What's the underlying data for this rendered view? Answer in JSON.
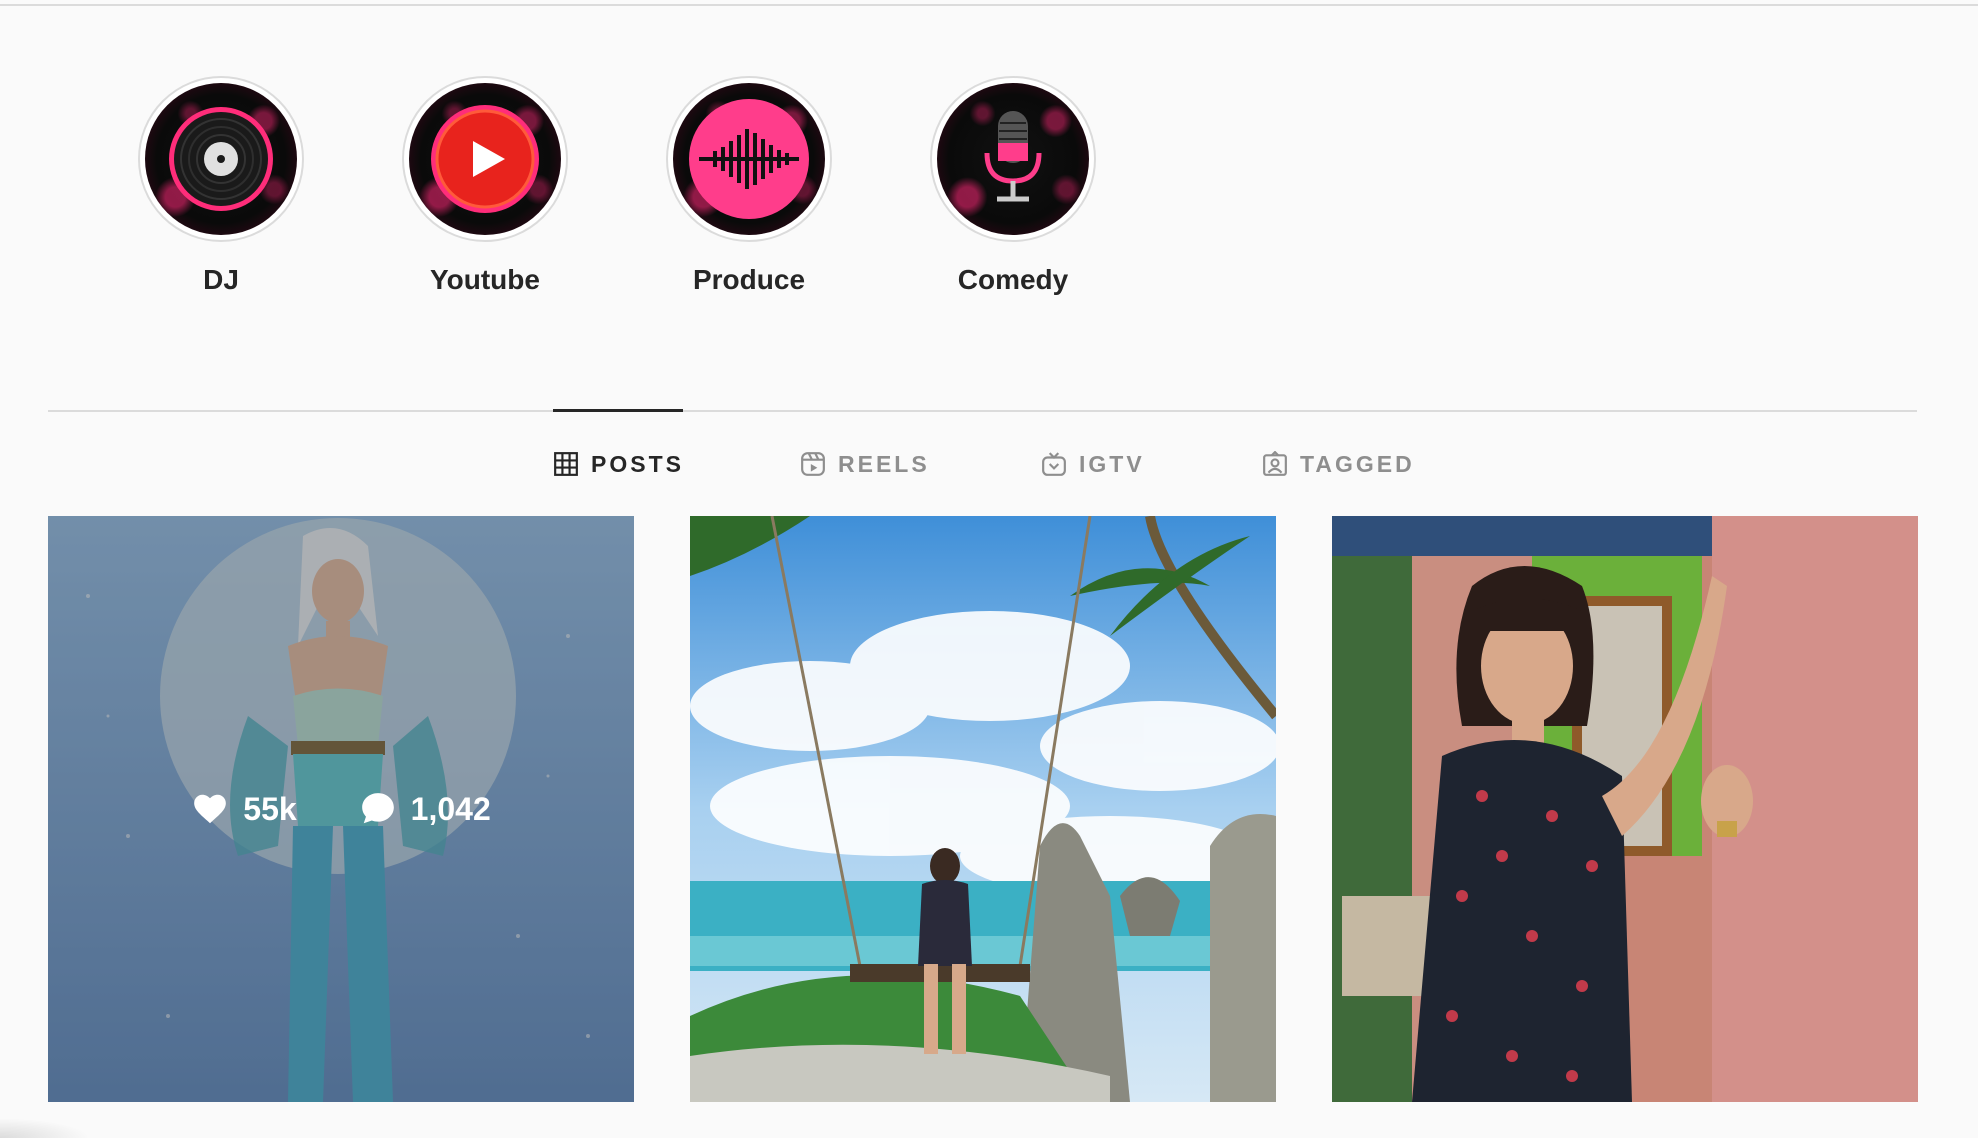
{
  "highlights": [
    {
      "label": "DJ",
      "icon": "vinyl-record-icon"
    },
    {
      "label": "Youtube",
      "icon": "play-button-icon"
    },
    {
      "label": "Produce",
      "icon": "sound-wave-icon"
    },
    {
      "label": "Comedy",
      "icon": "microphone-icon"
    }
  ],
  "tabs": [
    {
      "label": "POSTS",
      "icon": "grid-icon",
      "active": true
    },
    {
      "label": "REELS",
      "icon": "reels-icon",
      "active": false
    },
    {
      "label": "IGTV",
      "icon": "igtv-icon",
      "active": false
    },
    {
      "label": "TAGGED",
      "icon": "tagged-icon",
      "active": false
    }
  ],
  "posts": [
    {
      "likes": "55k",
      "comments": "1,042",
      "hovered": true
    },
    {
      "hovered": false
    },
    {
      "hovered": false
    }
  ],
  "colors": {
    "accent_pink": "#ff3d8b",
    "text_primary": "#262626",
    "text_secondary": "#8e8e8e",
    "divider": "#dbdbdb",
    "background": "#fafafa"
  }
}
